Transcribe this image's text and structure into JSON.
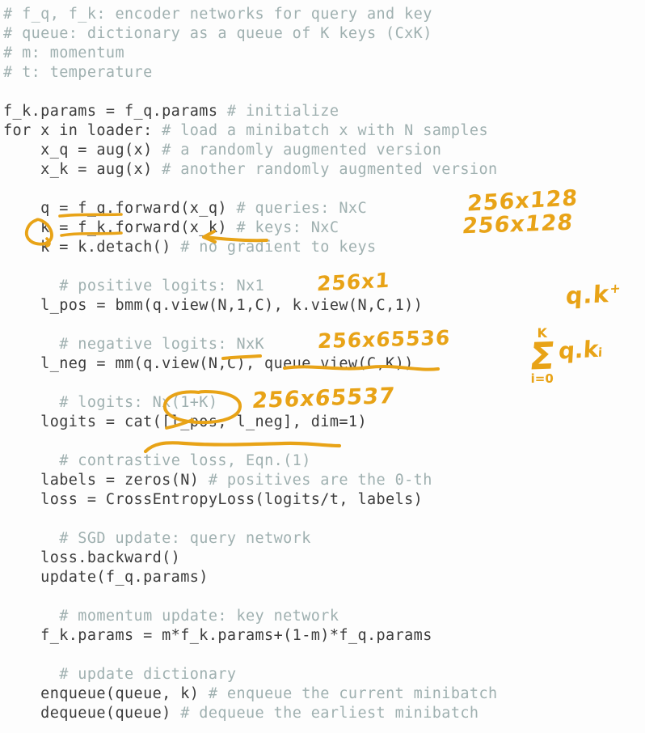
{
  "page": {
    "kind": "pseudocode-slide-with-handwritten-annotations",
    "background_color": "#fdfdfd",
    "code_color": "#3c3c3c",
    "comment_color": "#9fb0b0",
    "ink_color": "#e8a317"
  },
  "code": {
    "lines": [
      {
        "indent": 0,
        "code": "",
        "comment": "# f_q, f_k: encoder networks for query and key"
      },
      {
        "indent": 0,
        "code": "",
        "comment": "# queue: dictionary as a queue of K keys (CxK)"
      },
      {
        "indent": 0,
        "code": "",
        "comment": "# m: momentum"
      },
      {
        "indent": 0,
        "code": "",
        "comment": "# t: temperature"
      },
      {
        "indent": 0,
        "code": "",
        "comment": ""
      },
      {
        "indent": 0,
        "code": "f_k.params = f_q.params ",
        "comment": "# initialize"
      },
      {
        "indent": 0,
        "code": "for x in loader: ",
        "comment": "# load a minibatch x with N samples"
      },
      {
        "indent": 2,
        "code": "x_q = aug(x) ",
        "comment": "# a randomly augmented version"
      },
      {
        "indent": 2,
        "code": "x_k = aug(x) ",
        "comment": "# another randomly augmented version"
      },
      {
        "indent": 0,
        "code": "",
        "comment": ""
      },
      {
        "indent": 2,
        "code": "q = f_q.forward(x_q) ",
        "comment": "# queries: NxC"
      },
      {
        "indent": 2,
        "code": "k = f_k.forward(x_k) ",
        "comment": "# keys: NxC"
      },
      {
        "indent": 2,
        "code": "k = k.detach() ",
        "comment": "# no gradient to keys"
      },
      {
        "indent": 0,
        "code": "",
        "comment": ""
      },
      {
        "indent": 3,
        "code": "",
        "comment": "# positive logits: Nx1"
      },
      {
        "indent": 2,
        "code": "l_pos = bmm(q.view(N,1,C), k.view(N,C,1))",
        "comment": ""
      },
      {
        "indent": 0,
        "code": "",
        "comment": ""
      },
      {
        "indent": 3,
        "code": "",
        "comment": "# negative logits: NxK"
      },
      {
        "indent": 2,
        "code": "l_neg = mm(q.view(N,C), queue.view(C,K))",
        "comment": ""
      },
      {
        "indent": 0,
        "code": "",
        "comment": ""
      },
      {
        "indent": 3,
        "code": "",
        "comment": "# logits: Nx(1+K)"
      },
      {
        "indent": 2,
        "code": "logits = cat([l_pos, l_neg], dim=1)",
        "comment": ""
      },
      {
        "indent": 0,
        "code": "",
        "comment": ""
      },
      {
        "indent": 3,
        "code": "",
        "comment": "# contrastive loss, Eqn.(1)"
      },
      {
        "indent": 2,
        "code": "labels = zeros(N) ",
        "comment": "# positives are the 0-th"
      },
      {
        "indent": 2,
        "code": "loss = CrossEntropyLoss(logits/t, labels)",
        "comment": ""
      },
      {
        "indent": 0,
        "code": "",
        "comment": ""
      },
      {
        "indent": 3,
        "code": "",
        "comment": "# SGD update: query network"
      },
      {
        "indent": 2,
        "code": "loss.backward()",
        "comment": ""
      },
      {
        "indent": 2,
        "code": "update(f_q.params)",
        "comment": ""
      },
      {
        "indent": 0,
        "code": "",
        "comment": ""
      },
      {
        "indent": 3,
        "code": "",
        "comment": "# momentum update: key network"
      },
      {
        "indent": 2,
        "code": "f_k.params = m*f_k.params+(1-m)*f_q.params",
        "comment": ""
      },
      {
        "indent": 0,
        "code": "",
        "comment": ""
      },
      {
        "indent": 3,
        "code": "",
        "comment": "# update dictionary"
      },
      {
        "indent": 2,
        "code": "enqueue(queue, k) ",
        "comment": "# enqueue the current minibatch"
      },
      {
        "indent": 2,
        "code": "dequeue(queue) ",
        "comment": "# dequeue the earliest minibatch"
      }
    ]
  },
  "annotations": {
    "q_shape": "256x128",
    "k_shape": "256x128",
    "pos_logits_shape": "256x1",
    "neg_logits_shape": "256x65536",
    "logits_shape": "256x65537",
    "dot_positive": "q.k",
    "dot_positive_sup": "+",
    "sum_upper": "K",
    "sum_symbol": "Σ",
    "sum_lower": "i=0",
    "sum_term": "q.k",
    "sum_term_sub": "i"
  }
}
